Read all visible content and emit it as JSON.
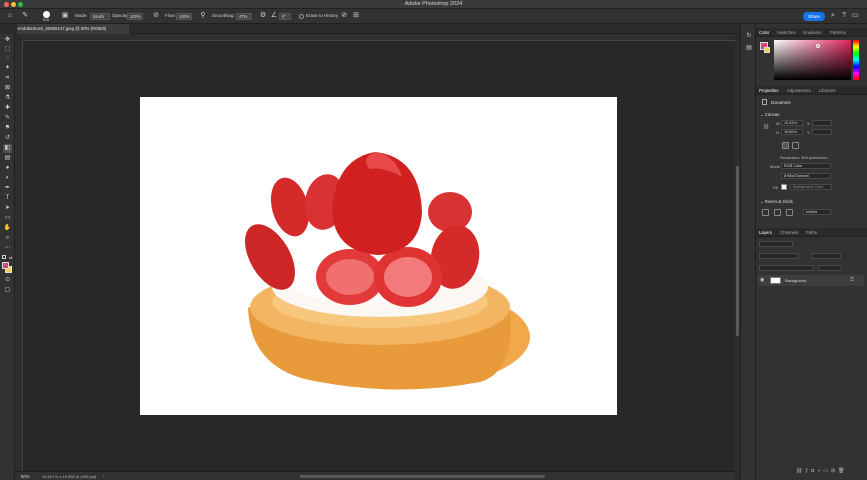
{
  "window": {
    "title": "Adobe Photoshop 2024"
  },
  "options_bar": {
    "brush_size": "519",
    "mode_label": "Mode:",
    "mode_value": "Brush",
    "opacity_label": "Opacity:",
    "opacity_value": "100%",
    "flow_label": "Flow:",
    "flow_value": "100%",
    "smoothing_label": "Smoothing:",
    "smoothing_value": "47%",
    "angle_value": "0°",
    "erase_to_history_label": "Erase to History",
    "share_label": "Share"
  },
  "document": {
    "tab_label": "AdobeStock_66805147.jpeg @ 50% (RGB/8)",
    "zoom_readout": "50%",
    "info": "10.417 in x 10.892 in (300 ppi)"
  },
  "panels": {
    "color_tabs": [
      "Color",
      "Swatches",
      "Gradients",
      "Patterns"
    ],
    "properties_tabs": [
      "Properties",
      "Adjustments",
      "Libraries"
    ],
    "properties_kind": "Document",
    "canvas_section": "Canvas",
    "width_label": "W",
    "width_value": "10.43 in",
    "height_label": "H",
    "height_value": "10.89 in",
    "x_label": "X",
    "y_label": "Y",
    "resolution": "Resolution: 300 pixels/inch",
    "mode_label": "Mode",
    "mode_value": "RGB Color",
    "bit_depth": "8 Bits/Channel",
    "fill_label": "Fill",
    "fill_value": "Background Color",
    "rulers_section": "Rulers & Grids",
    "ruler_units": "Inches",
    "layers_tabs": [
      "Layers",
      "Channels",
      "Paths"
    ],
    "layer_name": "Background"
  },
  "colors": {
    "accent": "#1473e6",
    "foreground_swatch": "#d9467a",
    "background_swatch": "#f0d050"
  }
}
